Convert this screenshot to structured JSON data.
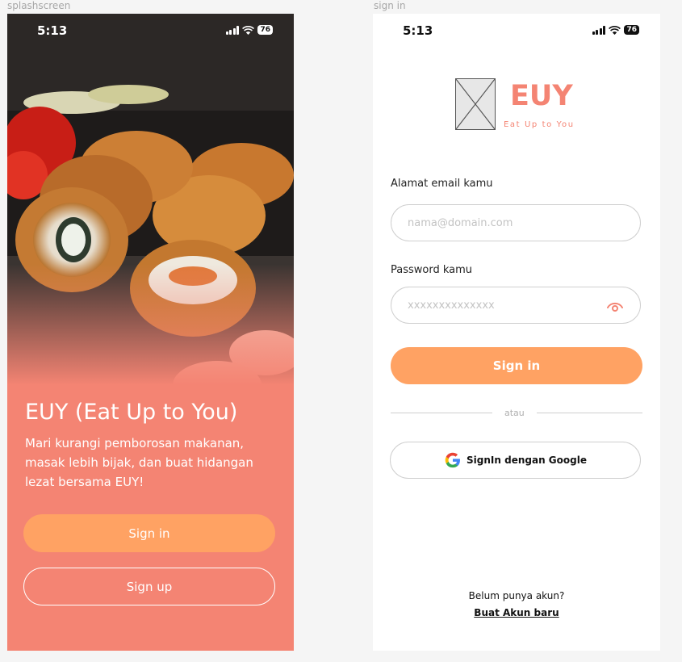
{
  "frames": {
    "splash_label": "splashscreen",
    "signin_label": "sign in"
  },
  "status_bar": {
    "time": "5:13",
    "battery": "76"
  },
  "splash": {
    "title": "EUY (Eat Up to You)",
    "description": "Mari kurangi pemborosan makanan, masak lebih bijak, dan buat hidangan lezat bersama EUY!",
    "signin_label": "Sign in",
    "signup_label": "Sign up"
  },
  "signin": {
    "logo_text": "EUY",
    "tagline": "Eat Up to You",
    "email_label": "Alamat email kamu",
    "email_placeholder": "nama@domain.com",
    "password_label": "Password kamu",
    "password_placeholder": "xxxxxxxxxxxxxx",
    "signin_label": "Sign in",
    "divider_text": "atau",
    "google_label": "SignIn dengan Google",
    "no_account_text": "Belum punya akun?",
    "create_account_label": "Buat Akun baru"
  },
  "colors": {
    "accent": "#ffa263",
    "brand": "#f48473"
  },
  "icons": [
    "signal-icon",
    "wifi-icon",
    "battery-icon",
    "image-placeholder-icon",
    "eye-icon",
    "google-icon"
  ]
}
